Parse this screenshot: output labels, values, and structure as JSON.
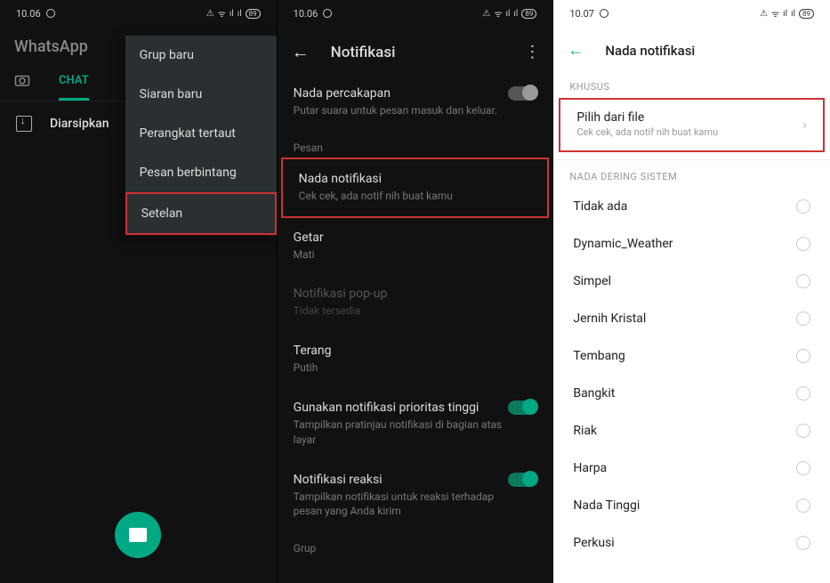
{
  "status": {
    "time1": "10.06",
    "time2": "10.06",
    "time3": "10.07",
    "battery": "89",
    "icons": "⚠ ᯤ ₐₗₗ ₐₗₗ"
  },
  "panel1": {
    "appTitle": "WhatsApp",
    "tabChat": "CHAT",
    "archiveLabel": "Diarsipkan",
    "menu": {
      "item0": "Grup baru",
      "item1": "Siaran baru",
      "item2": "Perangkat tertaut",
      "item3": "Pesan berbintang",
      "item4": "Setelan"
    }
  },
  "panel2": {
    "title": "Notifikasi",
    "conv": {
      "title": "Nada percakapan",
      "sub": "Putar suara untuk pesan masuk dan keluar."
    },
    "sectionPesan": "Pesan",
    "notif": {
      "title": "Nada notifikasi",
      "sub": "Cek cek, ada notif nih buat kamu"
    },
    "getar": {
      "title": "Getar",
      "sub": "Mati"
    },
    "popup": {
      "title": "Notifikasi pop-up",
      "sub": "Tidak tersedia"
    },
    "terang": {
      "title": "Terang",
      "sub": "Putih"
    },
    "priority": {
      "title": "Gunakan notifikasi prioritas tinggi",
      "sub": "Tampilkan pratinjau notifikasi di bagian atas layar"
    },
    "reaction": {
      "title": "Notifikasi reaksi",
      "sub": "Tampilkan notifikasi untuk reaksi terhadap pesan yang Anda kirim"
    },
    "sectionGrup": "Grup"
  },
  "panel3": {
    "title": "Nada notifikasi",
    "sectionKhusus": "KHUSUS",
    "pick": {
      "title": "Pilih dari file",
      "sub": "Cek cek, ada notif nih buat kamu"
    },
    "sectionSystem": "NADA DERING SISTEM",
    "tones": {
      "t0": "Tidak ada",
      "t1": "Dynamic_Weather",
      "t2": "Simpel",
      "t3": "Jernih Kristal",
      "t4": "Tembang",
      "t5": "Bangkit",
      "t6": "Riak",
      "t7": "Harpa",
      "t8": "Nada Tinggi",
      "t9": "Perkusi"
    }
  }
}
